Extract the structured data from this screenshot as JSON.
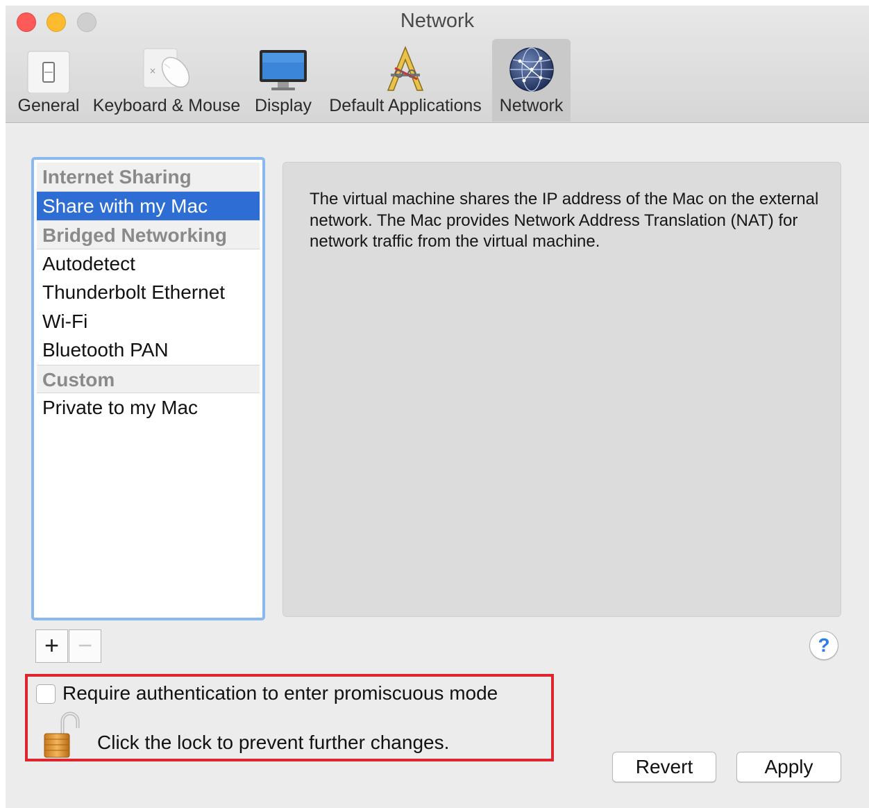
{
  "window": {
    "title": "Network"
  },
  "toolbar": {
    "items": [
      {
        "label": "General",
        "icon": "switch-icon",
        "selected": false
      },
      {
        "label": "Keyboard & Mouse",
        "icon": "mouse-icon",
        "selected": false
      },
      {
        "label": "Display",
        "icon": "monitor-icon",
        "selected": false
      },
      {
        "label": "Default Applications",
        "icon": "applications-icon",
        "selected": false
      },
      {
        "label": "Network",
        "icon": "globe-icon",
        "selected": true
      }
    ]
  },
  "network_list": {
    "rows": [
      {
        "type": "header",
        "label": "Internet Sharing"
      },
      {
        "type": "item",
        "label": "Share with my Mac",
        "selected": true
      },
      {
        "type": "header",
        "label": "Bridged Networking"
      },
      {
        "type": "item",
        "label": "Autodetect"
      },
      {
        "type": "item",
        "label": "Thunderbolt Ethernet"
      },
      {
        "type": "item",
        "label": "Wi-Fi"
      },
      {
        "type": "item",
        "label": "Bluetooth PAN"
      },
      {
        "type": "header",
        "label": "Custom"
      },
      {
        "type": "item",
        "label": "Private to my Mac"
      }
    ]
  },
  "description": {
    "text": "The virtual machine shares the IP address of the Mac on the external network. The Mac provides Network Address Translation (NAT) for network traffic from the virtual machine."
  },
  "controls": {
    "add_label": "+",
    "remove_label": "−",
    "help_label": "?"
  },
  "security": {
    "checkbox_label": "Require authentication to enter promiscuous mode",
    "checkbox_checked": false,
    "lock_label": "Click the lock to prevent further changes."
  },
  "buttons": {
    "revert_label": "Revert",
    "apply_label": "Apply"
  },
  "colors": {
    "selection": "#2e6ed4",
    "focus_ring": "#8ab8ef",
    "highlight_box": "#e0242f",
    "help_icon": "#2f7bea"
  }
}
